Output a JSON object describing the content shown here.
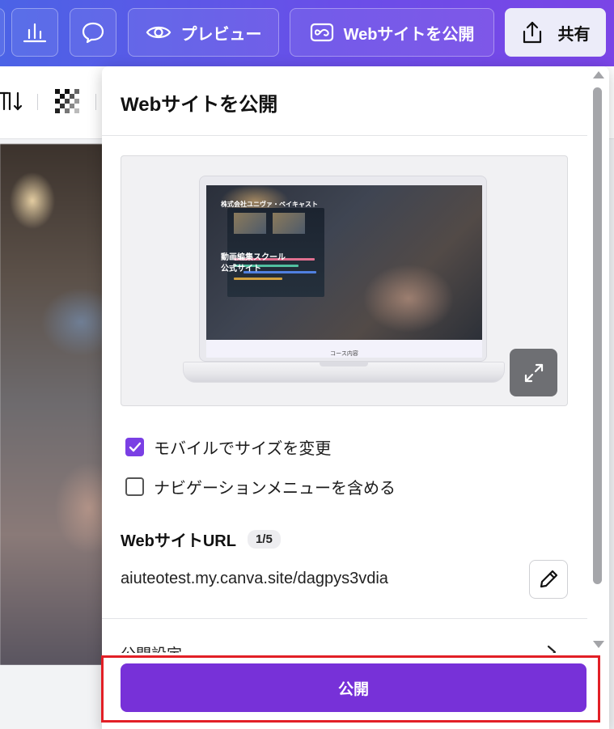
{
  "toolbar": {
    "preview_label": "プレビュー",
    "publish_web_label": "Webサイトを公開",
    "share_label": "共有"
  },
  "panel": {
    "title": "Webサイトを公開",
    "preview": {
      "site_company": "株式会社ユニヴァ・ペイキャスト",
      "site_heading": "動画編集スクール\n公式サイト",
      "site_section": "コース内容"
    },
    "options": [
      {
        "label": "モバイルでサイズを変更",
        "checked": true
      },
      {
        "label": "ナビゲーションメニューを含める",
        "checked": false
      }
    ],
    "url_heading": "WebサイトURL",
    "url_count": "1/5",
    "url": "aiuteotest.my.canva.site/dagpys3vdia",
    "settings_label": "公開設定",
    "publish_button": "公開"
  },
  "colors": {
    "accent": "#7731d8",
    "checkbox_checked": "#7a3fe4",
    "highlight": "#e21f26"
  }
}
